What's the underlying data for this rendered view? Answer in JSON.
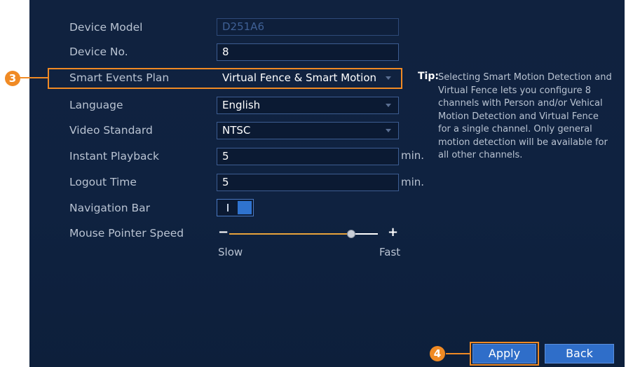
{
  "settings": {
    "device_model": {
      "label": "Device Model",
      "value": "D251A6"
    },
    "device_no": {
      "label": "Device No.",
      "value": "8"
    },
    "smart_events_plan": {
      "label": "Smart Events Plan",
      "value": "Virtual Fence & Smart Motion"
    },
    "language": {
      "label": "Language",
      "value": "English"
    },
    "video_standard": {
      "label": "Video Standard",
      "value": "NTSC"
    },
    "instant_playback": {
      "label": "Instant Playback",
      "value": "5",
      "unit": "min."
    },
    "logout_time": {
      "label": "Logout Time",
      "value": "5",
      "unit": "min."
    },
    "navigation_bar": {
      "label": "Navigation Bar",
      "toggle_on": true
    },
    "mouse_pointer_speed": {
      "label": "Mouse Pointer Speed",
      "minus": "−",
      "plus": "+",
      "min_label": "Slow",
      "max_label": "Fast",
      "level": 0.83
    }
  },
  "tip": {
    "heading": "Tip:",
    "text": "Selecting Smart Motion Detection and Virtual Fence lets you configure 8 channels with Person and/or Vehical Motion Detection and Virtual Fence for a single channel. Only general motion detection will be available for all other channels."
  },
  "callouts": {
    "step3": "3",
    "step4": "4"
  },
  "buttons": {
    "apply": "Apply",
    "back": "Back"
  },
  "colors": {
    "background": "#10223f",
    "accent": "#f08a24",
    "button": "#2f6ec9",
    "slider_fill": "#e8a33b"
  }
}
